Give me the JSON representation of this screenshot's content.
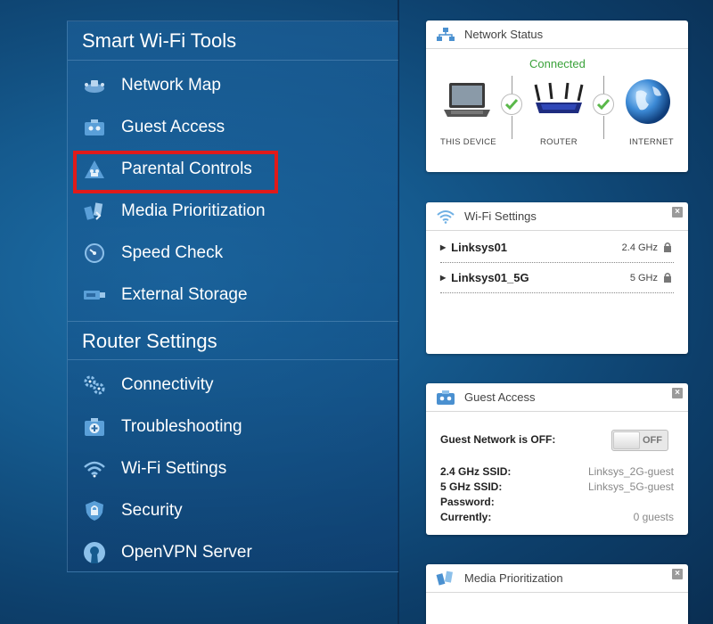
{
  "sidebar": {
    "tools_title": "Smart Wi-Fi Tools",
    "tools": [
      {
        "label": "Network Map",
        "icon": "network-map-icon"
      },
      {
        "label": "Guest Access",
        "icon": "guest-access-icon"
      },
      {
        "label": "Parental Controls",
        "icon": "parental-controls-icon",
        "highlighted": true
      },
      {
        "label": "Media Prioritization",
        "icon": "media-prioritization-icon"
      },
      {
        "label": "Speed Check",
        "icon": "speed-check-icon"
      },
      {
        "label": "External Storage",
        "icon": "usb-storage-icon"
      }
    ],
    "router_title": "Router Settings",
    "router": [
      {
        "label": "Connectivity",
        "icon": "gears-icon"
      },
      {
        "label": "Troubleshooting",
        "icon": "first-aid-icon"
      },
      {
        "label": "Wi-Fi Settings",
        "icon": "wifi-icon"
      },
      {
        "label": "Security",
        "icon": "shield-lock-icon"
      },
      {
        "label": "OpenVPN Server",
        "icon": "openvpn-icon"
      }
    ]
  },
  "network_status": {
    "title": "Network Status",
    "connected": "Connected",
    "this_device": "THIS DEVICE",
    "router": "ROUTER",
    "internet": "INTERNET"
  },
  "wifi_settings": {
    "title": "Wi-Fi Settings",
    "networks": [
      {
        "ssid": "Linksys01",
        "band": "2.4 GHz"
      },
      {
        "ssid": "Linksys01_5G",
        "band": "5 GHz"
      }
    ]
  },
  "guest_access": {
    "title": "Guest Access",
    "status_label": "Guest Network is OFF:",
    "toggle_label": "OFF",
    "ssid_24_label": "2.4 GHz SSID:",
    "ssid_24_value": "Linksys_2G-guest",
    "ssid_5_label": "5 GHz SSID:",
    "ssid_5_value": "Linksys_5G-guest",
    "password_label": "Password:",
    "currently_label": "Currently:",
    "currently_value": "0 guests"
  },
  "media_prioritization": {
    "title": "Media Prioritization"
  },
  "colors": {
    "highlight": "#e01a1a",
    "connected": "#3aa23a",
    "background": "#155a8e"
  }
}
